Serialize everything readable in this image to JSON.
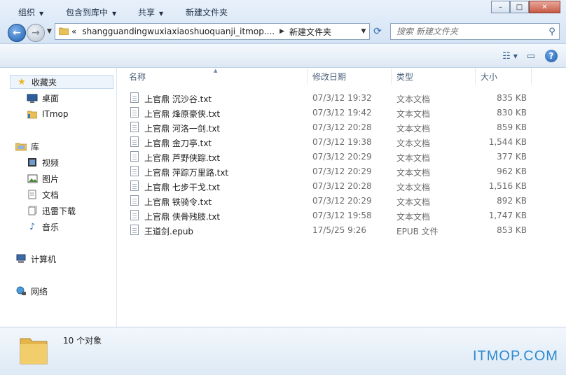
{
  "window": {
    "controls": {
      "minimize": "–",
      "maximize": "□",
      "close": "✕"
    }
  },
  "address": {
    "chevron": "«",
    "path_segments": [
      "shangguandingwuxiaxiaoshuoquanji_itmop....",
      "新建文件夹"
    ],
    "search_placeholder": "搜索 新建文件夹"
  },
  "toolbar": {
    "organize": "组织",
    "include_in_library": "包含到库中",
    "share": "共享",
    "new_folder": "新建文件夹"
  },
  "sidebar": {
    "favorites": "收藏夹",
    "favorites_children": [
      "桌面",
      "ITmop"
    ],
    "libraries": "库",
    "libraries_children": [
      "视频",
      "图片",
      "文档",
      "迅雷下载",
      "音乐"
    ],
    "computer": "计算机",
    "network": "网络"
  },
  "columns": {
    "name": "名称",
    "date": "修改日期",
    "type": "类型",
    "size": "大小"
  },
  "files": [
    {
      "name": "上官鼎 沉沙谷.txt",
      "date": "07/3/12 19:32",
      "type": "文本文档",
      "size": "835 KB"
    },
    {
      "name": "上官鼎 烽原豪侠.txt",
      "date": "07/3/12 19:42",
      "type": "文本文档",
      "size": "830 KB"
    },
    {
      "name": "上官鼎 河洛一剑.txt",
      "date": "07/3/12 20:28",
      "type": "文本文档",
      "size": "859 KB"
    },
    {
      "name": "上官鼎 金刀亭.txt",
      "date": "07/3/12 19:38",
      "type": "文本文档",
      "size": "1,544 KB"
    },
    {
      "name": "上官鼎 芦野侠踪.txt",
      "date": "07/3/12 20:29",
      "type": "文本文档",
      "size": "377 KB"
    },
    {
      "name": "上官鼎 萍踪万里路.txt",
      "date": "07/3/12 20:29",
      "type": "文本文档",
      "size": "962 KB"
    },
    {
      "name": "上官鼎 七步干戈.txt",
      "date": "07/3/12 20:28",
      "type": "文本文档",
      "size": "1,516 KB"
    },
    {
      "name": "上官鼎 铁骑令.txt",
      "date": "07/3/12 20:29",
      "type": "文本文档",
      "size": "892 KB"
    },
    {
      "name": "上官鼎 侠骨残肢.txt",
      "date": "07/3/12 19:58",
      "type": "文本文档",
      "size": "1,747 KB"
    },
    {
      "name": "王道剑.epub",
      "date": "17/5/25 9:26",
      "type": "EPUB 文件",
      "size": "853 KB"
    }
  ],
  "status": {
    "item_count": "10 个对象"
  },
  "watermark": "ITMOP.COM",
  "colors": {
    "accent": "#2f8ad0",
    "selection": "#eef4fb"
  }
}
